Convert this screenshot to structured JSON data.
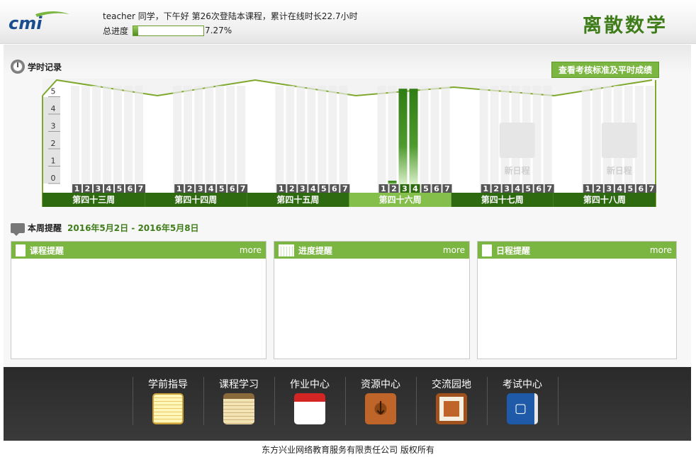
{
  "header": {
    "logo_text": "cmi",
    "greeting": "teacher 同学，下午好  第26次登陆本课程，累计在线时长22.7小时",
    "progress_label": "总进度",
    "progress_value": 7.27,
    "progress_text": "7.27%",
    "course_title": "离散数学"
  },
  "record": {
    "title": "学时记录",
    "standard_button": "查看考核标准及平时成绩"
  },
  "chart_data": {
    "type": "bar",
    "y_ticks": [
      "5",
      "4",
      "3",
      "2",
      "1",
      "0"
    ],
    "ylim": [
      0,
      5
    ],
    "day_labels": [
      "1",
      "2",
      "3",
      "4",
      "5",
      "6",
      "7"
    ],
    "weeks": [
      {
        "label": "第四十三周",
        "values": [
          0,
          0,
          0,
          0,
          0,
          0,
          0
        ],
        "current": false,
        "note": ""
      },
      {
        "label": "第四十四周",
        "values": [
          0,
          0,
          0,
          0,
          0,
          0,
          0
        ],
        "current": false,
        "note": ""
      },
      {
        "label": "第四十五周",
        "values": [
          0,
          0,
          0,
          0,
          0,
          0,
          0
        ],
        "current": false,
        "note": ""
      },
      {
        "label": "第四十六周",
        "values": [
          0,
          0.2,
          5.5,
          5.5,
          0,
          0,
          0
        ],
        "current": true,
        "note": ""
      },
      {
        "label": "第四十七周",
        "values": [
          0,
          0,
          0,
          0,
          0,
          0,
          0
        ],
        "current": false,
        "note": "新日程"
      },
      {
        "label": "第四十八周",
        "values": [
          0,
          0,
          0,
          0,
          0,
          0,
          0
        ],
        "current": false,
        "note": "新日程"
      }
    ],
    "colors": {
      "bar": "#3a8a1e",
      "band": "#2e6b10",
      "band_current": "#84bf4b",
      "frame": "#7fa82e"
    }
  },
  "reminder": {
    "title": "本周提醒",
    "date_range": "2016年5月2日 - 2016年5月8日",
    "cards": [
      {
        "title": "课程提醒",
        "more": "more"
      },
      {
        "title": "进度提醒",
        "more": "more"
      },
      {
        "title": "日程提醒",
        "more": "more"
      }
    ]
  },
  "nav": {
    "items": [
      {
        "label": "学前指导",
        "icon": "notepad-icon"
      },
      {
        "label": "课程学习",
        "icon": "notebook-icon"
      },
      {
        "label": "作业中心",
        "icon": "calendar-icon"
      },
      {
        "label": "资源中心",
        "icon": "download-icon"
      },
      {
        "label": "交流园地",
        "icon": "chat-icon"
      },
      {
        "label": "考试中心",
        "icon": "book-icon"
      }
    ]
  },
  "footer": {
    "text": "东方兴业网络教育服务有限责任公司     版权所有"
  }
}
